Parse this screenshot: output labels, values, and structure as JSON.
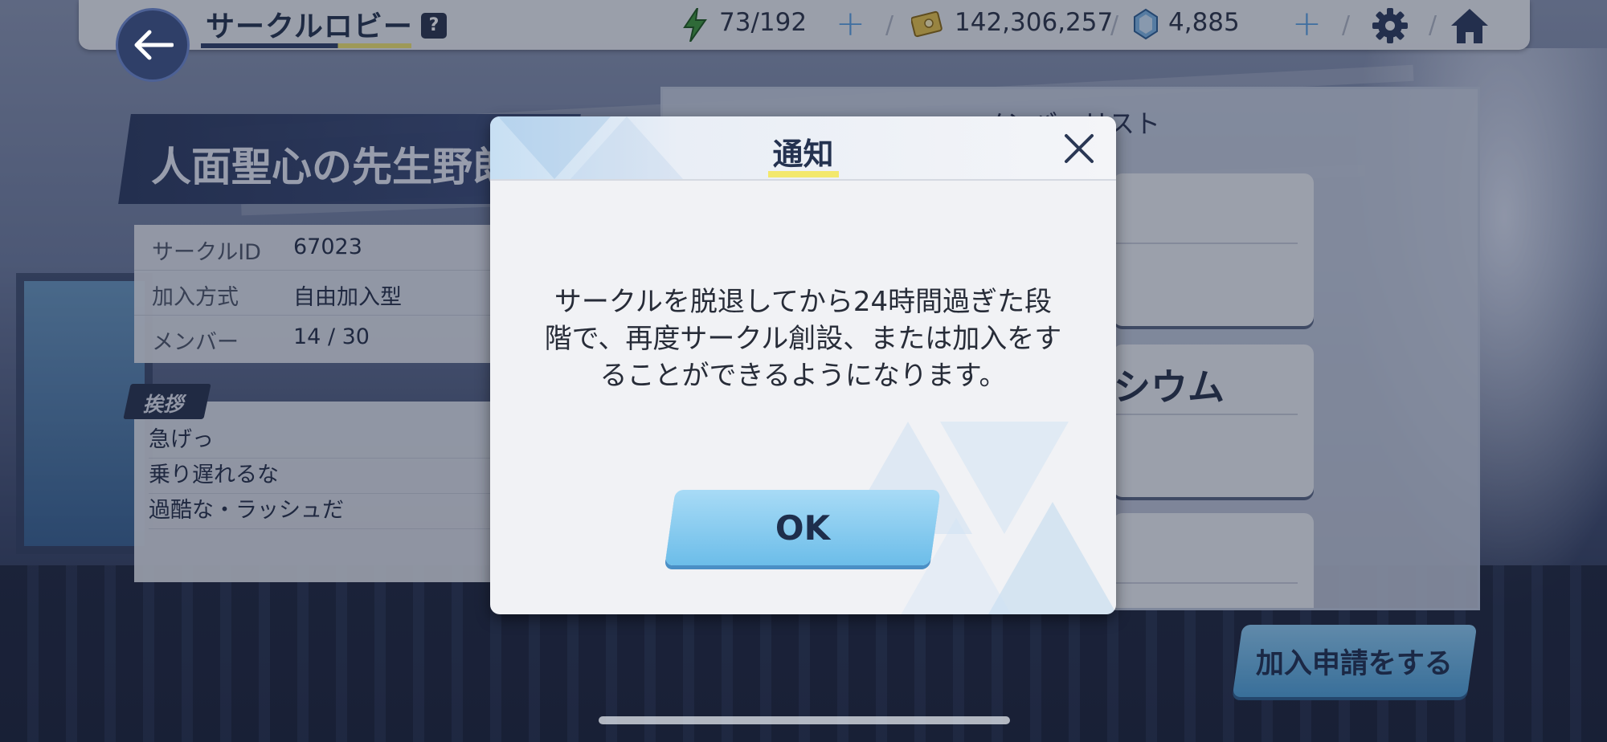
{
  "topbar": {
    "title": "サークルロビー",
    "help": "?",
    "stamina": "73/192",
    "credits": "142,306,257",
    "gems": "4,885"
  },
  "circle": {
    "name": "人面聖心の先生野郎",
    "info": [
      {
        "label": "サークルID",
        "value": "67023"
      },
      {
        "label": "加入方式",
        "value": "自由加入型"
      },
      {
        "label": "メンバー",
        "value": "14 / 30"
      }
    ],
    "greeting_label": "挨拶",
    "greeting_lines": [
      "急げっ",
      "乗り遅れるな",
      "過酷な・ラッシュだ"
    ]
  },
  "member_list": {
    "title": "メンバーリスト",
    "visible_name_fragment": "シウム"
  },
  "apply_button": "加入申請をする",
  "dialog": {
    "title": "通知",
    "message_lines": [
      "サークルを脱退してから24時間過ぎた段",
      "階で、再度サークル創設、または加入をす",
      "ることができるようになります。"
    ],
    "ok": "OK"
  },
  "icons": {
    "back": "arrow-left-icon",
    "stamina": "lightning-icon",
    "credits": "credit-card-icon",
    "gems": "gem-icon",
    "settings": "gear-icon",
    "home": "home-icon",
    "close": "close-icon"
  },
  "colors": {
    "accent_blue": "#6cbde9",
    "title_underline": "#f3e86c",
    "navy": "#243250"
  }
}
